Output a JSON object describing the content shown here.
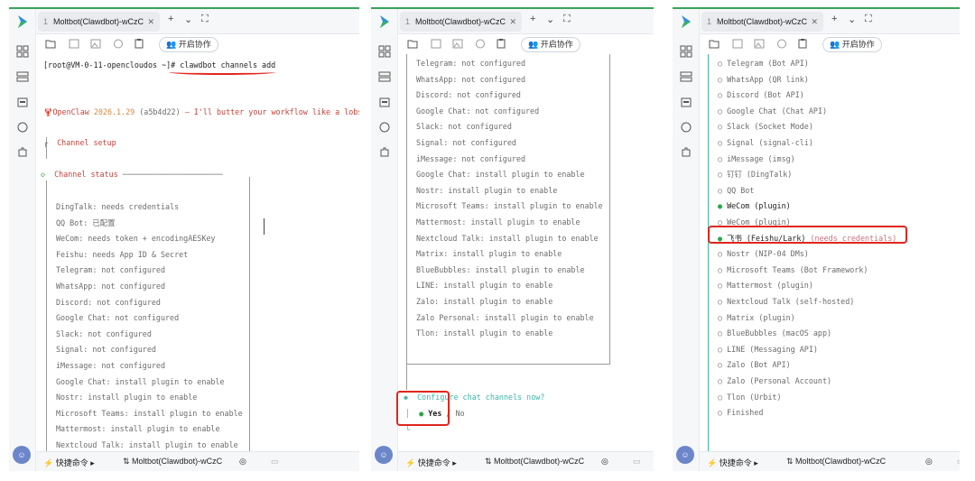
{
  "window": {
    "tab_num": "1",
    "tab_title": "Moltbot(Clawdbot)-wCzC",
    "tab_close": "✕",
    "new_tab": "+",
    "dropdown": "⌄",
    "expand": "⛶",
    "collab_label": "开启协作"
  },
  "statusbar": {
    "shortcut_label": "快捷命令",
    "session_label": "Moltbot(Clawdbot)-wCzC"
  },
  "panel1": {
    "prompt": "[root@VM-0-11-opencloudos ~]# ",
    "command": "clawdbot channels add",
    "banner_name": "OpenClaw",
    "banner_version": "2026.1.29",
    "banner_hash": "(a5b4d22)",
    "banner_text": "— I'll butter your workflow like a lobst",
    "channel_setup": "Channel setup",
    "channel_status": "Channel status",
    "status_lines": [
      "DingTalk: needs credentials",
      "QQ Bot: 已配置",
      "WeCom: needs token + encodingAESKey",
      "Feishu: needs App ID & Secret",
      "Telegram: not configured",
      "WhatsApp: not configured",
      "Discord: not configured",
      "Google Chat: not configured",
      "Slack: not configured",
      "Signal: not configured",
      "iMessage: not configured",
      "Google Chat: install plugin to enable",
      "Nostr: install plugin to enable",
      "Microsoft Teams: install plugin to enable",
      "Mattermost: install plugin to enable",
      "Nextcloud Talk: install plugin to enable"
    ]
  },
  "panel2": {
    "status_lines": [
      "Telegram: not configured",
      "WhatsApp: not configured",
      "Discord: not configured",
      "Google Chat: not configured",
      "Slack: not configured",
      "Signal: not configured",
      "iMessage: not configured",
      "Google Chat: install plugin to enable",
      "Nostr: install plugin to enable",
      "Microsoft Teams: install plugin to enable",
      "Mattermost: install plugin to enable",
      "Nextcloud Talk: install plugin to enable",
      "Matrix: install plugin to enable",
      "BlueBubbles: install plugin to enable",
      "LINE: install plugin to enable",
      "Zalo: install plugin to enable",
      "Zalo Personal: install plugin to enable",
      "Tlon: install plugin to enable"
    ],
    "question": "Configure chat channels now?",
    "yes": "Yes",
    "sep": " / ",
    "no": "No"
  },
  "panel3": {
    "options": [
      {
        "bullet": "○",
        "label": "Telegram (Bot API)"
      },
      {
        "bullet": "○",
        "label": "WhatsApp (QR link)"
      },
      {
        "bullet": "○",
        "label": "Discord (Bot API)"
      },
      {
        "bullet": "○",
        "label": "Google Chat (Chat API)"
      },
      {
        "bullet": "○",
        "label": "Slack (Socket Mode)"
      },
      {
        "bullet": "○",
        "label": "Signal (signal-cli)"
      },
      {
        "bullet": "○",
        "label": "iMessage (imsg)"
      },
      {
        "bullet": "○",
        "label": "钉钉 (DingTalk)"
      },
      {
        "bullet": "○",
        "label": "QQ Bot"
      },
      {
        "bullet": "●",
        "label": "WeCom (plugin)"
      },
      {
        "bullet": "○",
        "label": "WeCom (plugin)"
      },
      {
        "bullet": "●",
        "label": "飞书 (Feishu/Lark)",
        "hint": "(needs credentials)"
      },
      {
        "bullet": "○",
        "label": "Nostr (NIP-04 DMs)"
      },
      {
        "bullet": "○",
        "label": "Microsoft Teams (Bot Framework)"
      },
      {
        "bullet": "○",
        "label": "Mattermost (plugin)"
      },
      {
        "bullet": "○",
        "label": "Nextcloud Talk (self-hosted)"
      },
      {
        "bullet": "○",
        "label": "Matrix (plugin)"
      },
      {
        "bullet": "○",
        "label": "BlueBubbles (macOS app)"
      },
      {
        "bullet": "○",
        "label": "LINE (Messaging API)"
      },
      {
        "bullet": "○",
        "label": "Zalo (Bot API)"
      },
      {
        "bullet": "○",
        "label": "Zalo (Personal Account)"
      },
      {
        "bullet": "○",
        "label": "Tlon (Urbit)"
      },
      {
        "bullet": "○",
        "label": "Finished"
      }
    ]
  },
  "colors": {
    "accent_green": "#3aa35a",
    "annotation_red": "#e0261c",
    "warning_orange": "#d9883d"
  }
}
